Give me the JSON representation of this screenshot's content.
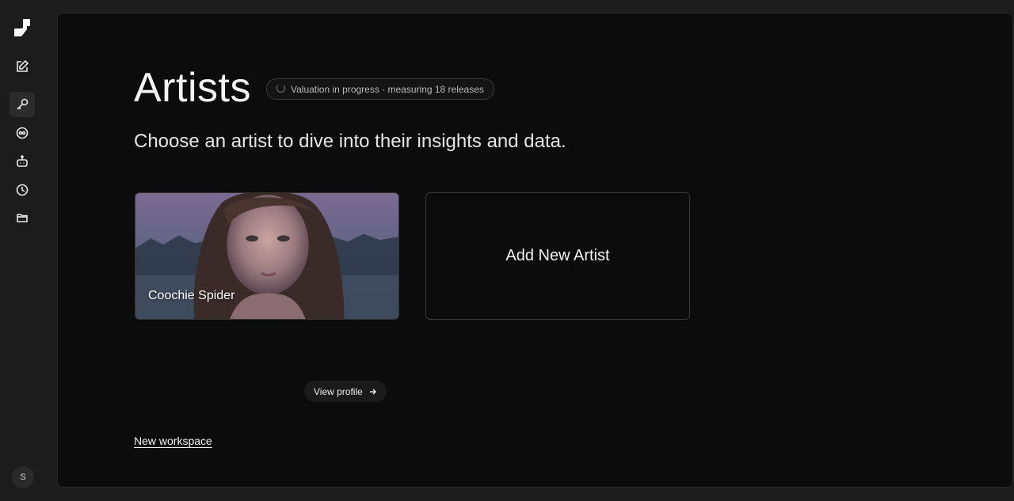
{
  "sidebar": {
    "logo": "app-logo",
    "items": [
      {
        "icon": "edit-icon"
      },
      {
        "icon": "key-icon",
        "active": true
      },
      {
        "icon": "record-icon"
      },
      {
        "icon": "robot-icon"
      },
      {
        "icon": "clock-icon"
      },
      {
        "icon": "folder-icon"
      }
    ],
    "user_initial": "S"
  },
  "main": {
    "title": "Artists",
    "status": "Valuation in progress · measuring 18 releases",
    "subtitle": "Choose an artist to dive into their insights and data.",
    "artists": [
      {
        "name": "Coochie Spider"
      }
    ],
    "add_artist_label": "Add New Artist",
    "view_profile_label": "View profile",
    "view_profile_icon": "arrow-right-icon",
    "new_workspace_label": "New workspace"
  }
}
